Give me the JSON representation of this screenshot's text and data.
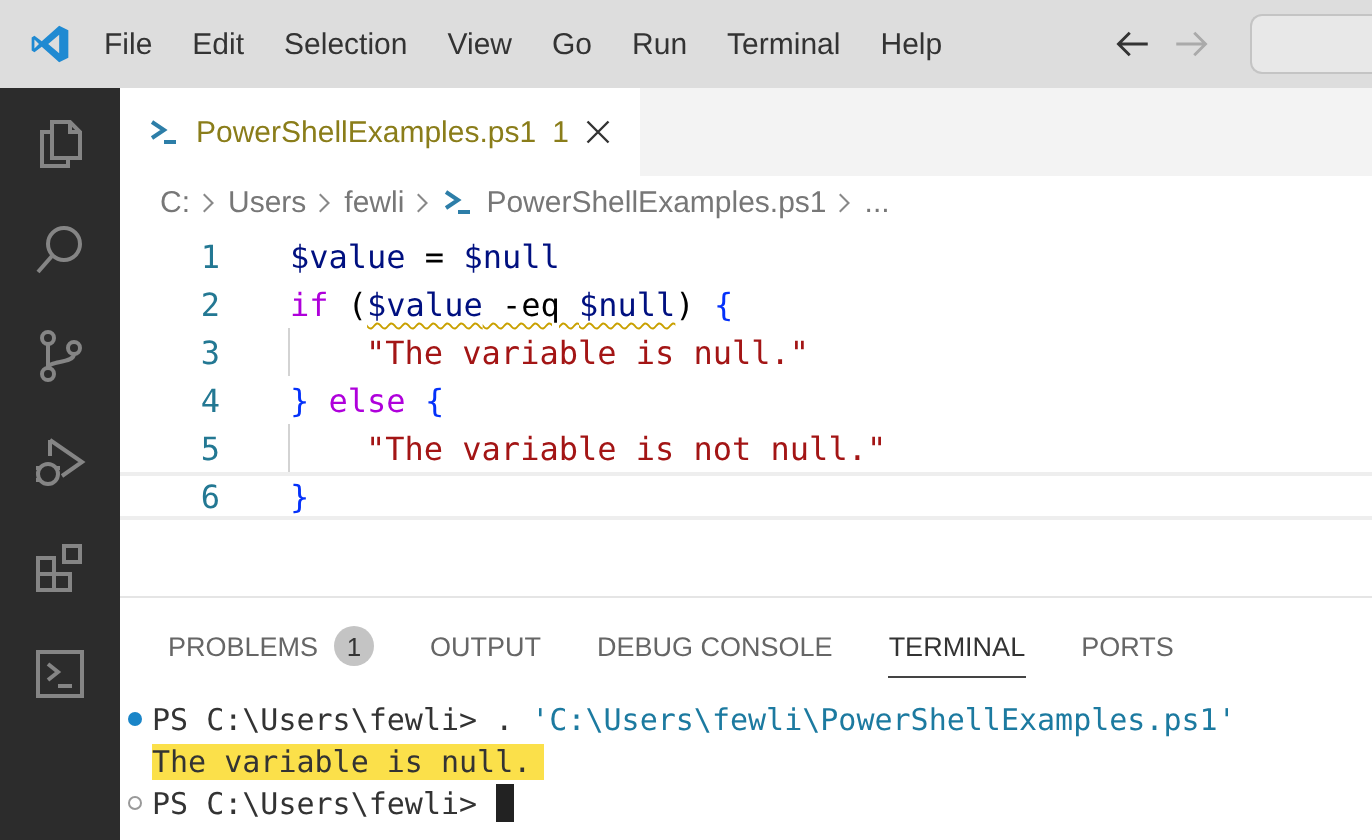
{
  "menu": [
    "File",
    "Edit",
    "Selection",
    "View",
    "Go",
    "Run",
    "Terminal",
    "Help"
  ],
  "nav": [
    {
      "kind": "back",
      "disabled": false
    },
    {
      "kind": "forward",
      "disabled": true
    }
  ],
  "activity_bar": [
    {
      "kind": "files",
      "selected": false
    },
    {
      "kind": "search",
      "selected": false
    },
    {
      "kind": "source-control",
      "selected": false
    },
    {
      "kind": "run-debug",
      "selected": false
    },
    {
      "kind": "extensions",
      "selected": false
    },
    {
      "kind": "terminal",
      "selected": false
    }
  ],
  "editor_tabs": [
    {
      "name": "PowerShellExamples.ps1",
      "problems": "1",
      "selected": true
    }
  ],
  "breadcrumbs": [
    {
      "label": "C:",
      "kind": "folder"
    },
    {
      "label": "Users",
      "kind": "folder"
    },
    {
      "label": "fewli",
      "kind": "folder"
    },
    {
      "label": "PowerShellExamples.ps1",
      "kind": "file"
    },
    {
      "label": "...",
      "kind": "more"
    }
  ],
  "code": [
    {
      "number": "1",
      "indented": false,
      "current": false,
      "tokens": [
        {
          "text": "$value",
          "kind": "var",
          "warning": false
        },
        {
          "text": " = ",
          "kind": "plain",
          "warning": false
        },
        {
          "text": "$null",
          "kind": "var",
          "warning": false
        }
      ]
    },
    {
      "number": "2",
      "indented": false,
      "current": false,
      "tokens": [
        {
          "text": "if",
          "kind": "keyword",
          "warning": false
        },
        {
          "text": " (",
          "kind": "plain",
          "warning": false
        },
        {
          "text": "$value",
          "kind": "var",
          "warning": true
        },
        {
          "text": " -eq ",
          "kind": "plain",
          "warning": true
        },
        {
          "text": "$null",
          "kind": "var",
          "warning": true
        },
        {
          "text": ") ",
          "kind": "plain",
          "warning": false
        },
        {
          "text": "{",
          "kind": "brace",
          "warning": false
        }
      ]
    },
    {
      "number": "3",
      "indented": true,
      "current": false,
      "tokens": [
        {
          "text": "\"The variable is null.\"",
          "kind": "string",
          "warning": false
        }
      ]
    },
    {
      "number": "4",
      "indented": false,
      "current": false,
      "tokens": [
        {
          "text": "}",
          "kind": "brace",
          "warning": false
        },
        {
          "text": " else ",
          "kind": "keyword",
          "warning": false
        },
        {
          "text": "{",
          "kind": "brace",
          "warning": false
        }
      ]
    },
    {
      "number": "5",
      "indented": true,
      "current": false,
      "tokens": [
        {
          "text": "\"The variable is not null.\"",
          "kind": "string",
          "warning": false
        }
      ]
    },
    {
      "number": "6",
      "indented": false,
      "current": true,
      "tokens": [
        {
          "text": "}",
          "kind": "brace",
          "warning": false
        }
      ]
    }
  ],
  "panel_tabs": [
    {
      "label": "PROBLEMS",
      "badge": "1",
      "selected": false
    },
    {
      "label": "OUTPUT",
      "selected": false
    },
    {
      "label": "DEBUG CONSOLE",
      "selected": false
    },
    {
      "label": "TERMINAL",
      "selected": true
    },
    {
      "label": "PORTS",
      "selected": false
    }
  ],
  "terminal": [
    {
      "kind": "prompt",
      "finished": true,
      "prompt": "PS C:\\Users\\fewli> . ",
      "argument": "'C:\\Users\\fewli\\PowerShellExamples.ps1'",
      "cursor": false
    },
    {
      "kind": "output",
      "text": "The variable is null.",
      "highlighted": true
    },
    {
      "kind": "prompt",
      "finished": false,
      "prompt": "PS C:\\Users\\fewli>",
      "cursor": true
    }
  ]
}
